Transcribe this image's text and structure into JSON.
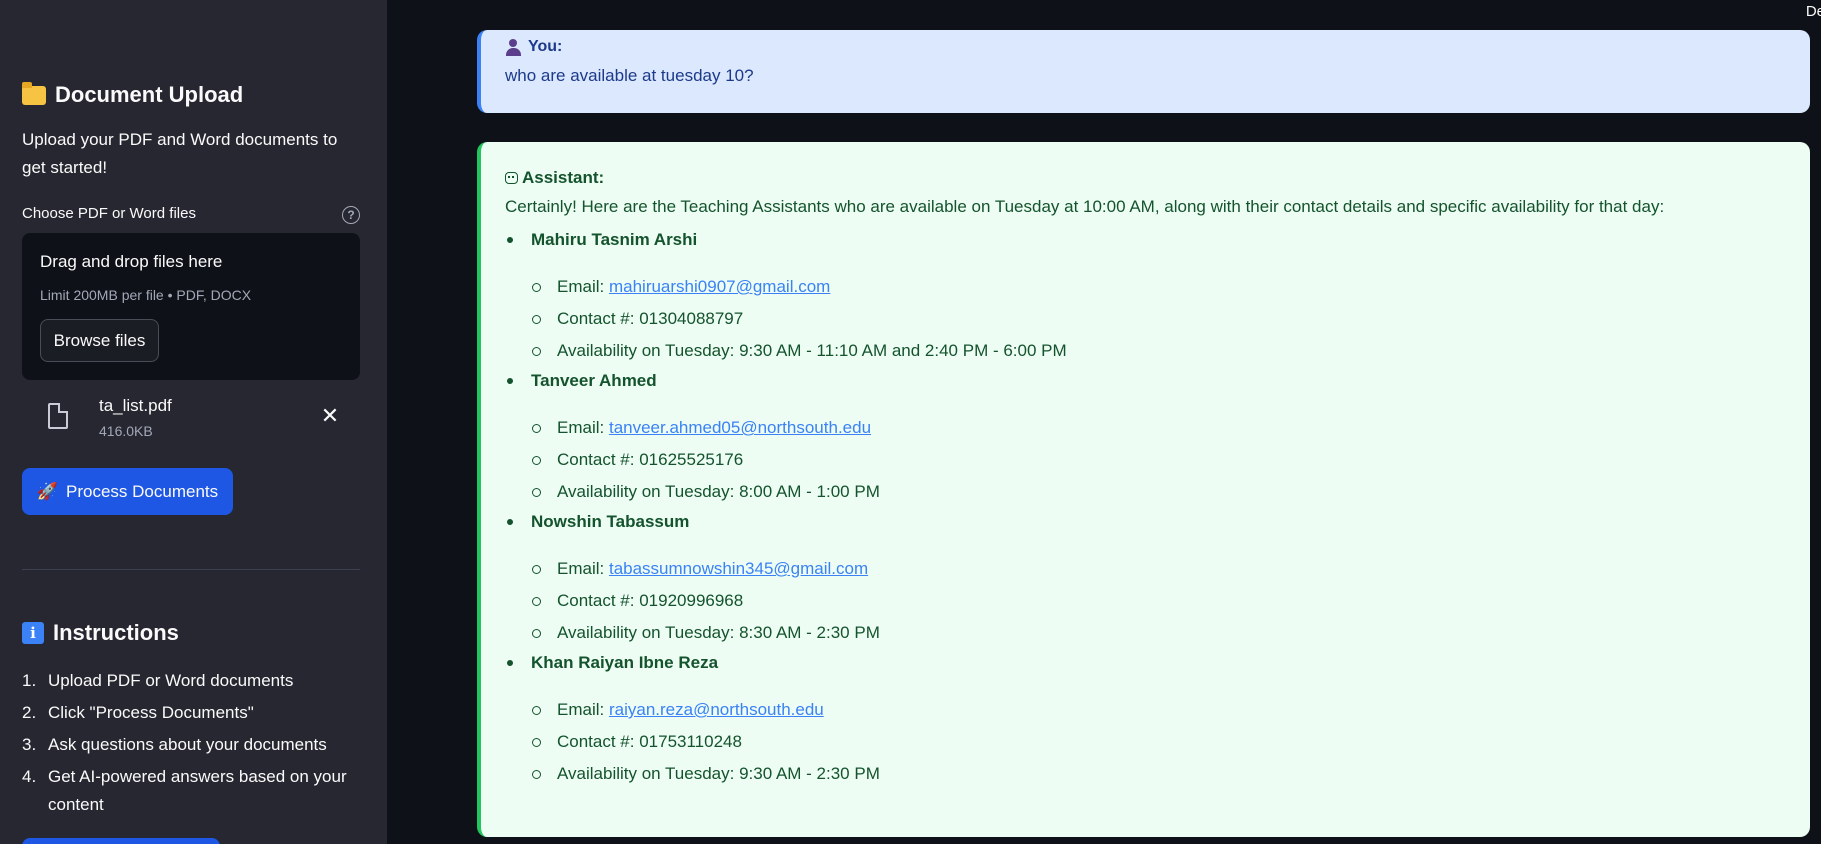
{
  "sidebar": {
    "upload_title": "Document Upload",
    "upload_desc": "Upload your PDF and Word documents to get started!",
    "choose_label": "Choose PDF or Word files",
    "help_glyph": "?",
    "dropzone_title": "Drag and drop files here",
    "dropzone_limit": "Limit 200MB per file • PDF, DOCX",
    "browse_label": "Browse files",
    "file": {
      "name": "ta_list.pdf",
      "size": "416.0KB"
    },
    "close_glyph": "✕",
    "process_label": "Process Documents",
    "process_emoji": "🚀",
    "instructions_title": "Instructions",
    "instructions": [
      {
        "num": "1.",
        "text": "Upload PDF or Word documents"
      },
      {
        "num": "2.",
        "text": "Click \"Process Documents\""
      },
      {
        "num": "3.",
        "text": "Ask questions about your documents"
      },
      {
        "num": "4.",
        "text": "Get AI-powered answers based on your content"
      }
    ]
  },
  "topbar": {
    "deploy_label": "De"
  },
  "chat": {
    "user": {
      "who": "You:",
      "text": "who are available at tuesday 10?"
    },
    "assistant": {
      "who": "Assistant:",
      "intro": "Certainly! Here are the Teaching Assistants who are available on Tuesday at 10:00 AM, along with their contact details and specific availability for that day:",
      "email_label": "Email: ",
      "tas": [
        {
          "name": "Mahiru Tasnim Arshi",
          "email": "mahiruarshi0907@gmail.com",
          "contact": "Contact #: 01304088797",
          "availability": "Availability on Tuesday: 9:30 AM - 11:10 AM and 2:40 PM - 6:00 PM"
        },
        {
          "name": "Tanveer Ahmed",
          "email": "tanveer.ahmed05@northsouth.edu",
          "contact": "Contact #: 01625525176",
          "availability": "Availability on Tuesday: 8:00 AM - 1:00 PM"
        },
        {
          "name": "Nowshin Tabassum",
          "email": "tabassumnowshin345@gmail.com",
          "contact": "Contact #: 01920996968",
          "availability": "Availability on Tuesday: 8:30 AM - 2:30 PM"
        },
        {
          "name": "Khan Raiyan Ibne Reza",
          "email": "raiyan.reza@northsouth.edu",
          "contact": "Contact #: 01753110248",
          "availability": "Availability on Tuesday: 9:30 AM - 2:30 PM"
        }
      ]
    }
  },
  "colors": {
    "sidebar_bg": "#262730",
    "main_bg": "#0e1117",
    "primary": "#1d57e3",
    "user_bg": "#dbe8fe",
    "assistant_bg": "#edfdf3",
    "assistant_border": "#22c55e"
  }
}
